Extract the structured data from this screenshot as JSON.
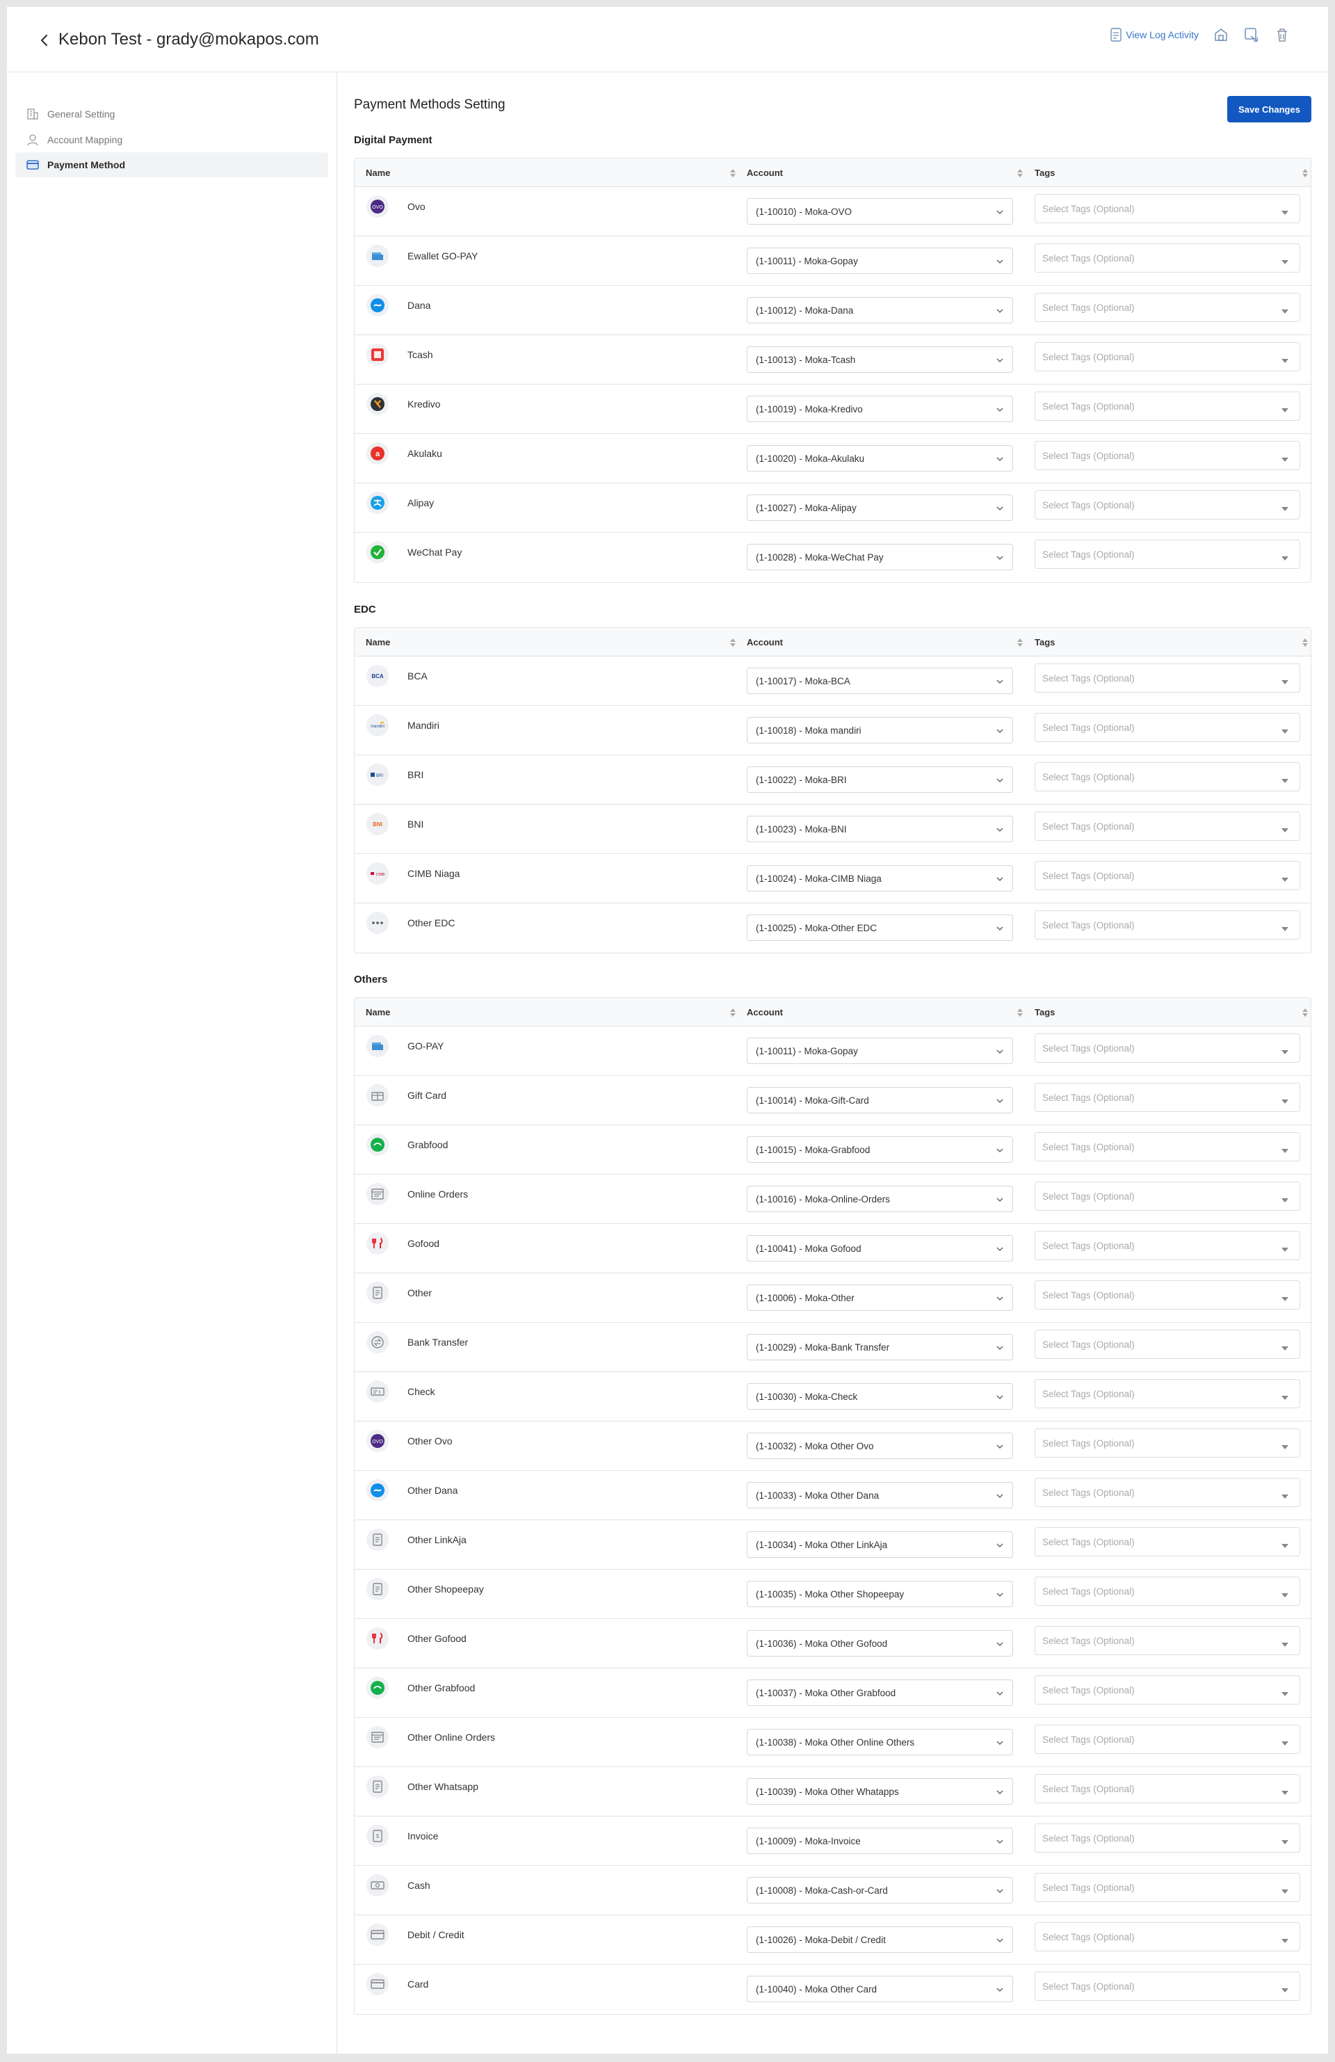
{
  "header": {
    "title": "Kebon Test - grady@mokapos.com",
    "log_activity": "View Log Activity"
  },
  "sidebar": {
    "items": [
      {
        "label": "General Setting",
        "icon": "building-icon"
      },
      {
        "label": "Account Mapping",
        "icon": "user-icon"
      },
      {
        "label": "Payment Method",
        "icon": "card-icon",
        "active": true
      }
    ]
  },
  "main": {
    "title": "Payment Methods Setting",
    "save_label": "Save Changes"
  },
  "columns": {
    "name": "Name",
    "account": "Account",
    "tags": "Tags"
  },
  "tags_placeholder": "Select Tags (Optional)",
  "colors": {
    "accent": "#1258c0",
    "link": "#3a78c8"
  },
  "sections": [
    {
      "title": "Digital Payment",
      "rows": [
        {
          "name": "Ovo",
          "account": "(1-10010) - Moka-OVO",
          "icon": "ovo-logo"
        },
        {
          "name": "Ewallet GO-PAY",
          "account": "(1-10011) - Moka-Gopay",
          "icon": "gopay-wallet-icon"
        },
        {
          "name": "Dana",
          "account": "(1-10012) - Moka-Dana",
          "icon": "dana-logo"
        },
        {
          "name": "Tcash",
          "account": "(1-10013) - Moka-Tcash",
          "icon": "tcash-logo"
        },
        {
          "name": "Kredivo",
          "account": "(1-10019) - Moka-Kredivo",
          "icon": "kredivo-logo"
        },
        {
          "name": "Akulaku",
          "account": "(1-10020) - Moka-Akulaku",
          "icon": "akulaku-logo"
        },
        {
          "name": "Alipay",
          "account": "(1-10027) - Moka-Alipay",
          "icon": "alipay-logo"
        },
        {
          "name": "WeChat Pay",
          "account": "(1-10028) - Moka-WeChat Pay",
          "icon": "wechat-logo"
        }
      ]
    },
    {
      "title": "EDC",
      "rows": [
        {
          "name": "BCA",
          "account": "(1-10017) - Moka-BCA",
          "icon": "bca-logo"
        },
        {
          "name": "Mandiri",
          "account": "(1-10018) - Moka mandiri",
          "icon": "mandiri-logo"
        },
        {
          "name": "BRI",
          "account": "(1-10022) - Moka-BRI",
          "icon": "bri-logo"
        },
        {
          "name": "BNI",
          "account": "(1-10023) - Moka-BNI",
          "icon": "bni-logo"
        },
        {
          "name": "CIMB Niaga",
          "account": "(1-10024) - Moka-CIMB Niaga",
          "icon": "cimb-logo"
        },
        {
          "name": "Other EDC",
          "account": "(1-10025) - Moka-Other EDC",
          "icon": "more-dots-icon"
        }
      ]
    },
    {
      "title": "Others",
      "rows": [
        {
          "name": "GO-PAY",
          "account": "(1-10011) - Moka-Gopay",
          "icon": "gopay-wallet-icon"
        },
        {
          "name": "Gift Card",
          "account": "(1-10014) - Moka-Gift-Card",
          "icon": "gift-card-icon"
        },
        {
          "name": "Grabfood",
          "account": "(1-10015) - Moka-Grabfood",
          "icon": "grabfood-logo"
        },
        {
          "name": "Online Orders",
          "account": "(1-10016) - Moka-Online-Orders",
          "icon": "online-orders-icon"
        },
        {
          "name": "Gofood",
          "account": "(1-10041) - Moka Gofood",
          "icon": "gofood-logo"
        },
        {
          "name": "Other",
          "account": "(1-10006) - Moka-Other",
          "icon": "document-icon"
        },
        {
          "name": "Bank Transfer",
          "account": "(1-10029) - Moka-Bank Transfer",
          "icon": "bank-transfer-icon"
        },
        {
          "name": "Check",
          "account": "(1-10030) - Moka-Check",
          "icon": "check-icon"
        },
        {
          "name": "Other Ovo",
          "account": "(1-10032) - Moka Other Ovo",
          "icon": "ovo-logo"
        },
        {
          "name": "Other Dana",
          "account": "(1-10033) - Moka Other Dana",
          "icon": "dana-logo"
        },
        {
          "name": "Other LinkAja",
          "account": "(1-10034) - Moka Other LinkAja",
          "icon": "document-icon"
        },
        {
          "name": "Other Shopeepay",
          "account": "(1-10035) - Moka Other Shopeepay",
          "icon": "document-icon"
        },
        {
          "name": "Other Gofood",
          "account": "(1-10036) - Moka Other Gofood",
          "icon": "gofood-logo"
        },
        {
          "name": "Other Grabfood",
          "account": "(1-10037) - Moka Other Grabfood",
          "icon": "grabfood-logo"
        },
        {
          "name": "Other Online Orders",
          "account": "(1-10038) - Moka Other Online Others",
          "icon": "online-orders-icon"
        },
        {
          "name": "Other Whatsapp",
          "account": "(1-10039) - Moka Other Whatapps",
          "icon": "document-icon"
        },
        {
          "name": "Invoice",
          "account": "(1-10009) - Moka-Invoice",
          "icon": "invoice-icon"
        },
        {
          "name": "Cash",
          "account": "(1-10008) - Moka-Cash-or-Card",
          "icon": "cash-icon"
        },
        {
          "name": "Debit / Credit",
          "account": "(1-10026) - Moka-Debit / Credit",
          "icon": "credit-card-icon"
        },
        {
          "name": "Card",
          "account": "(1-10040) - Moka Other Card",
          "icon": "credit-card-icon"
        }
      ]
    }
  ]
}
